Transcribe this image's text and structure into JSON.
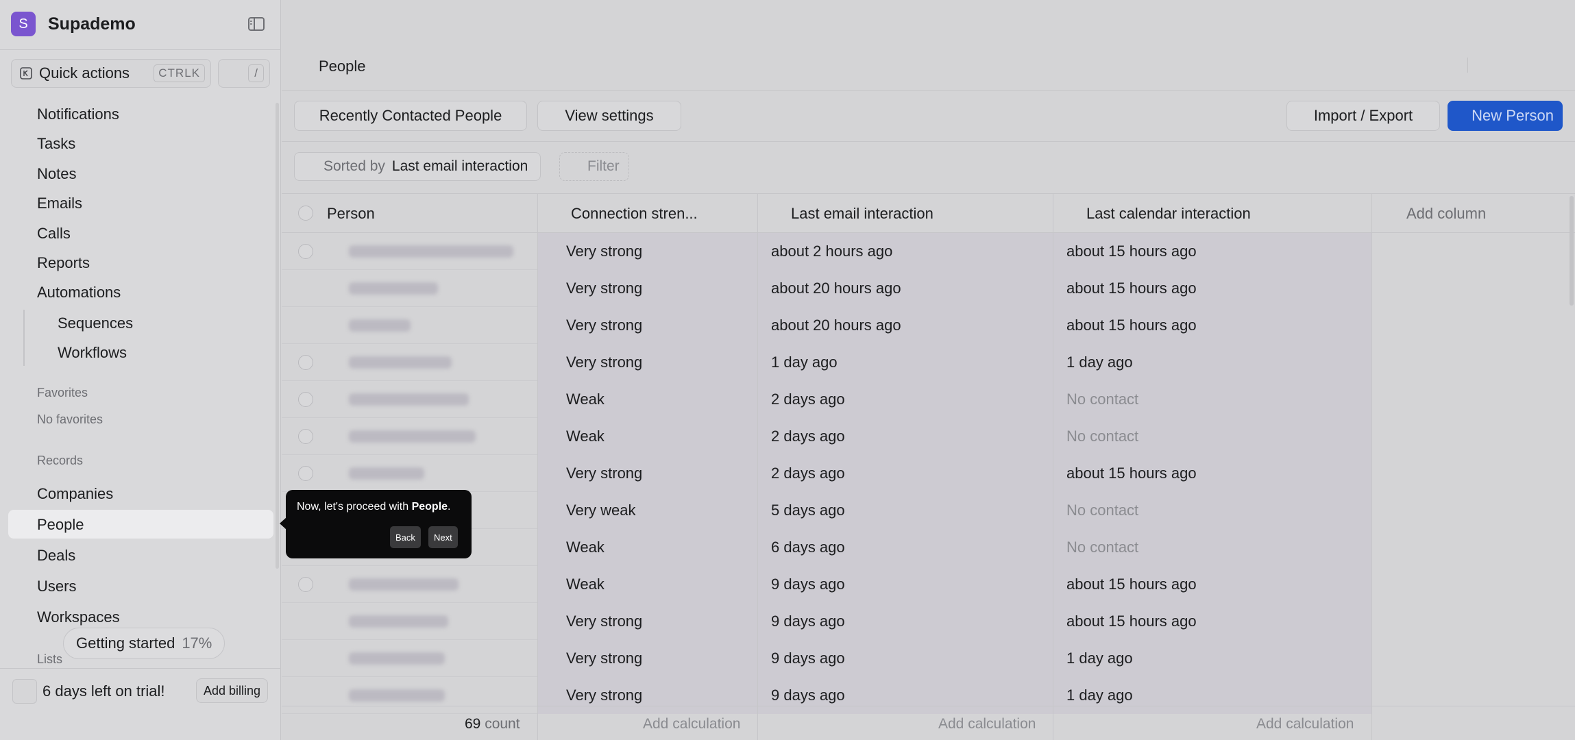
{
  "app": {
    "name": "Supademo",
    "logo_letter": "S",
    "accent": "#7a55cf"
  },
  "sidebar": {
    "quick_actions": {
      "label": "Quick actions",
      "shortcut": "CTRLK",
      "slash": "/"
    },
    "nav": [
      {
        "label": "Notifications"
      },
      {
        "label": "Tasks"
      },
      {
        "label": "Notes"
      },
      {
        "label": "Emails"
      },
      {
        "label": "Calls"
      },
      {
        "label": "Reports"
      },
      {
        "label": "Automations"
      }
    ],
    "automations_sub": [
      {
        "label": "Sequences"
      },
      {
        "label": "Workflows"
      }
    ],
    "favorites_label": "Favorites",
    "no_favorites": "No favorites",
    "records_label": "Records",
    "records": [
      {
        "label": "Companies"
      },
      {
        "label": "People"
      },
      {
        "label": "Deals"
      },
      {
        "label": "Users"
      },
      {
        "label": "Workspaces"
      }
    ],
    "getting_started": {
      "label": "Getting started",
      "percent": "17%"
    },
    "lists_label": "Lists",
    "trial": {
      "text": "6 days left on trial!",
      "billing_button": "Add billing"
    }
  },
  "main": {
    "title": "People",
    "view_button": "Recently Contacted People",
    "view_settings": "View settings",
    "import_export": "Import / Export",
    "new_person": "New Person",
    "primary_color": "#1f57c9",
    "sort": {
      "prefix": "Sorted by",
      "field": "Last email interaction"
    },
    "filter_label": "Filter"
  },
  "table": {
    "columns": {
      "person": "Person",
      "connection": "Connection stren...",
      "email": "Last email interaction",
      "calendar": "Last calendar interaction",
      "add": "Add column"
    },
    "rows": [
      {
        "connection": "Very strong",
        "email": "about 2 hours ago",
        "calendar": "about 15 hours ago",
        "calendar_muted": false
      },
      {
        "connection": "Very strong",
        "email": "about 20 hours ago",
        "calendar": "about 15 hours ago",
        "calendar_muted": false
      },
      {
        "connection": "Very strong",
        "email": "about 20 hours ago",
        "calendar": "about 15 hours ago",
        "calendar_muted": false
      },
      {
        "connection": "Very strong",
        "email": "1 day ago",
        "calendar": "1 day ago",
        "calendar_muted": false
      },
      {
        "connection": "Weak",
        "email": "2 days ago",
        "calendar": "No contact",
        "calendar_muted": true
      },
      {
        "connection": "Weak",
        "email": "2 days ago",
        "calendar": "No contact",
        "calendar_muted": true
      },
      {
        "connection": "Very strong",
        "email": "2 days ago",
        "calendar": "about 15 hours ago",
        "calendar_muted": false
      },
      {
        "connection": "Very weak",
        "email": "5 days ago",
        "calendar": "No contact",
        "calendar_muted": true
      },
      {
        "connection": "Weak",
        "email": "6 days ago",
        "calendar": "No contact",
        "calendar_muted": true
      },
      {
        "connection": "Weak",
        "email": "9 days ago",
        "calendar": "about 15 hours ago",
        "calendar_muted": false
      },
      {
        "connection": "Very strong",
        "email": "9 days ago",
        "calendar": "about 15 hours ago",
        "calendar_muted": false
      },
      {
        "connection": "Very strong",
        "email": "9 days ago",
        "calendar": "1 day ago",
        "calendar_muted": false
      },
      {
        "connection": "Very strong",
        "email": "9 days ago",
        "calendar": "1 day ago",
        "calendar_muted": false
      }
    ],
    "footer": {
      "count": "69",
      "count_label": "count",
      "add_calculation": "Add calculation"
    }
  },
  "tooltip": {
    "text_prefix": "Now, let's proceed with ",
    "text_bold": "People",
    "text_suffix": ".",
    "back": "Back",
    "next": "Next"
  }
}
